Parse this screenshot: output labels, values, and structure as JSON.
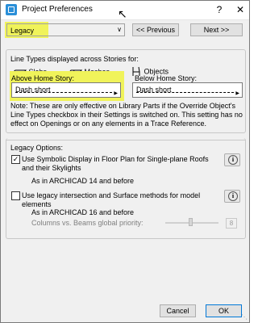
{
  "window": {
    "title": "Project Preferences",
    "help": "?",
    "close": "✕"
  },
  "toolbar": {
    "preset_value": "Legacy",
    "previous_label": "<< Previous",
    "next_label": "Next >>"
  },
  "line_types": {
    "heading": "Line Types displayed across Stories for:",
    "slabs": "Slabs",
    "meshes": "Meshes",
    "objects": "Objects",
    "above_label": "Above Home Story:",
    "above_value": "Dash short",
    "below_label": "Below Home Story:",
    "below_value": "Dash short",
    "note": "Note: These are only effective on Library Parts if the Override Object's Line Types checkbox in their Settings is switched on. This setting has no effect on Openings or on any elements in a Trace Reference."
  },
  "legacy": {
    "heading": "Legacy Options:",
    "option1_label": "Use Symbolic Display in Floor Plan for Single-plane Roofs and their Skylights",
    "option1_checked": true,
    "option1_note": "As in ARCHICAD 14 and before",
    "option2_label": "Use legacy intersection and Surface methods for model elements",
    "option2_checked": false,
    "option2_note": "As in ARCHICAD 16 and before",
    "priority_label": "Columns vs. Beams global priority:",
    "priority_value": "8",
    "info": "i"
  },
  "footer": {
    "cancel_label": "Cancel",
    "ok_label": "OK"
  },
  "colors": {
    "highlight": "#f0f35a",
    "accent": "#0078d7"
  }
}
